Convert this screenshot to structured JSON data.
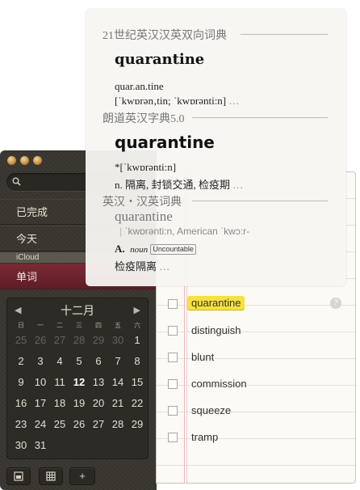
{
  "app": {
    "sidebar": {
      "items": [
        {
          "label": "已完成"
        },
        {
          "label": "今天"
        }
      ],
      "section_label": "iCloud",
      "selected_item": "单词"
    },
    "calendar": {
      "month": "十二月",
      "prev": "◀",
      "next": "▶",
      "weekdays": [
        "日",
        "一",
        "二",
        "三",
        "四",
        "五",
        "六"
      ],
      "weeks": [
        [
          "25",
          "26",
          "27",
          "28",
          "29",
          "30",
          "1"
        ],
        [
          "2",
          "3",
          "4",
          "5",
          "6",
          "7",
          "8"
        ],
        [
          "9",
          "10",
          "11",
          "12",
          "13",
          "14",
          "15"
        ],
        [
          "16",
          "17",
          "18",
          "19",
          "20",
          "21",
          "22"
        ],
        [
          "23",
          "24",
          "25",
          "26",
          "27",
          "28",
          "29"
        ],
        [
          "30",
          "31",
          "",
          "",
          "",
          "",
          ""
        ]
      ],
      "dim_days_first_row": 6,
      "today": "12"
    },
    "bottom_toolbar": {
      "add_label": "+"
    }
  },
  "notebook": {
    "words": [
      "quarantine",
      "distinguish",
      "blunt",
      "commission",
      "squeeze",
      "tramp"
    ],
    "highlighted": "quarantine",
    "highlight_color": "#f6e13f",
    "info_icon": "?"
  },
  "popup": {
    "dict1": {
      "source": "21世纪英汉汉英双向词典",
      "headword": "quarantine",
      "syllables": "quar.an.tine",
      "pron": "[ˈkwɒrən‚tin; ˈkwɒrənti:n]",
      "ellipsis": "…"
    },
    "dict2": {
      "source": "朗道英汉字典5.0",
      "headword": "quarantine",
      "pron": "*[ˈkwɒrənti:n]",
      "def": "n. 隔离, 封锁交通, 检疫期",
      "ellipsis": "…"
    },
    "dict3": {
      "source": "英汉・汉英词典",
      "headword": "quarantine",
      "pron": "ˈkwɒrənti:n, American ˈkwɔ:r-",
      "sense_letter": "A.",
      "pos": "noun",
      "tag": "Uncountable",
      "def": "检疫隔离",
      "ellipsis": "…"
    }
  }
}
